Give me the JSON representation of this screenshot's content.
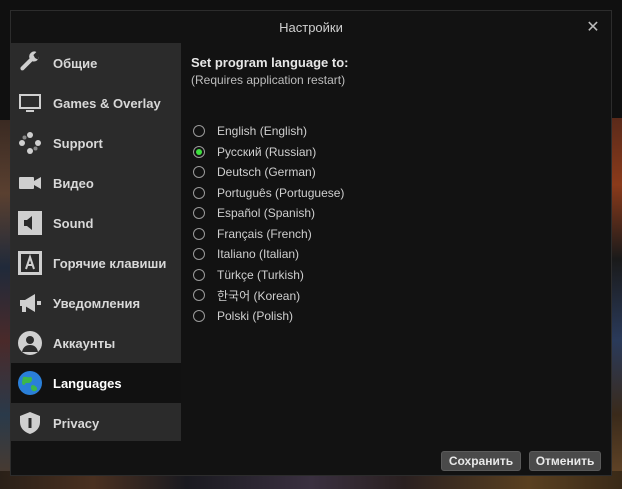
{
  "dialog": {
    "title": "Настройки",
    "close_symbol": "✕"
  },
  "sidebar": {
    "items": [
      {
        "label": "Общие",
        "icon": "wrench-icon",
        "active": false
      },
      {
        "label": "Games & Overlay",
        "icon": "monitor-icon",
        "active": false
      },
      {
        "label": "Support",
        "icon": "lifebuoy-icon",
        "active": false
      },
      {
        "label": "Видео",
        "icon": "video-camera-icon",
        "active": false
      },
      {
        "label": "Sound",
        "icon": "speaker-icon",
        "active": false
      },
      {
        "label": "Горячие клавиши",
        "icon": "hotkey-icon",
        "active": false
      },
      {
        "label": "Уведомления",
        "icon": "megaphone-icon",
        "active": false
      },
      {
        "label": "Аккаунты",
        "icon": "user-icon",
        "active": false
      },
      {
        "label": "Languages",
        "icon": "globe-icon",
        "active": true
      },
      {
        "label": "Privacy",
        "icon": "shield-icon",
        "active": false
      }
    ]
  },
  "content": {
    "heading": "Set program language to:",
    "subheading": "(Requires application restart)",
    "languages": [
      {
        "label": "English (English)",
        "checked": false
      },
      {
        "label": "Русский (Russian)",
        "checked": true
      },
      {
        "label": "Deutsch (German)",
        "checked": false
      },
      {
        "label": "Português (Portuguese)",
        "checked": false
      },
      {
        "label": "Español (Spanish)",
        "checked": false
      },
      {
        "label": "Français (French)",
        "checked": false
      },
      {
        "label": "Italiano (Italian)",
        "checked": false
      },
      {
        "label": "Türkçe (Turkish)",
        "checked": false
      },
      {
        "label": "한국어 (Korean)",
        "checked": false
      },
      {
        "label": "Polski (Polish)",
        "checked": false
      }
    ]
  },
  "footer": {
    "save_label": "Сохранить",
    "cancel_label": "Отменить"
  },
  "colors": {
    "accent_radio": "#3ee03e",
    "sidebar_bg": "#2b2b2b",
    "dialog_bg": "#121212"
  }
}
